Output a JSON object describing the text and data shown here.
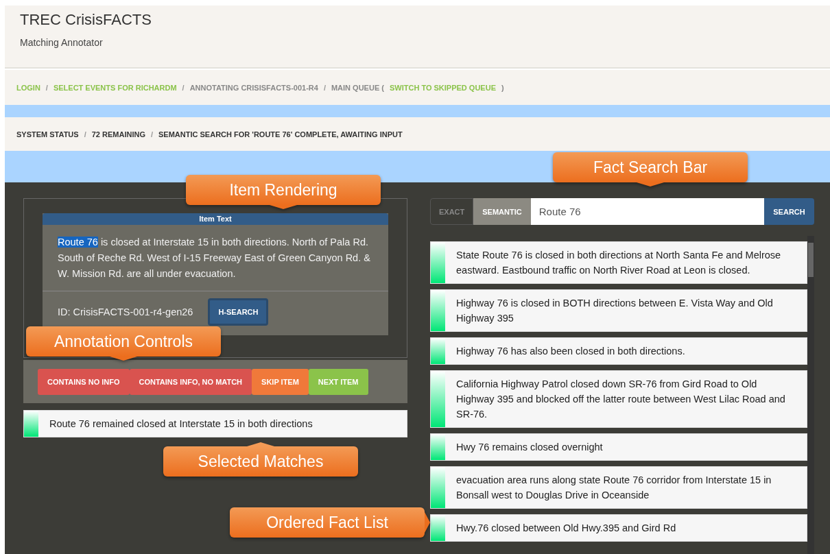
{
  "header": {
    "title": "TREC CrisisFACTS",
    "subtitle": "Matching Annotator"
  },
  "breadcrumb": [
    {
      "label": "LOGIN",
      "kind": "link"
    },
    {
      "label": "SELECT EVENTS FOR RICHARDM",
      "kind": "link"
    },
    {
      "label": "ANNOTATING CRISISFACTS-001-R4",
      "kind": "text"
    },
    {
      "label": "MAIN QUEUE (",
      "kind": "text",
      "link": "SWITCH TO SKIPPED QUEUE",
      "after": ")"
    }
  ],
  "status": [
    "SYSTEM STATUS",
    "72 REMAINING",
    "SEMANTIC SEARCH FOR 'ROUTE 76' COMPLETE, AWAITING INPUT"
  ],
  "item": {
    "header": "Item Text",
    "highlight": "Route 76",
    "text": " is closed at Interstate 15 in both directions. North of Pala Rd. South of Reche Rd. West of I-15 Freeway East of Green Canyon Rd. & W. Mission Rd. are all under evacuation.",
    "id": "ID: CrisisFACTS-001-r4-gen26",
    "button": "H-SEARCH"
  },
  "controls": [
    {
      "label": "CONTAINS NO INFO",
      "kind": "danger"
    },
    {
      "label": "CONTAINS INFO, NO MATCH",
      "kind": "danger"
    },
    {
      "label": "SKIP ITEM",
      "kind": "warning"
    },
    {
      "label": "NEXT ITEM",
      "kind": "success"
    }
  ],
  "selected_matches": [
    "Route 76 remained closed at Interstate 15 in both directions"
  ],
  "search": {
    "modes": [
      {
        "label": "EXACT",
        "selected": false
      },
      {
        "label": "SEMANTIC",
        "selected": true
      }
    ],
    "value": "Route 76",
    "button": "SEARCH"
  },
  "facts": [
    "State Route 76 is closed in both directions at North Santa Fe and Melrose eastward. Eastbound traffic on North River Road at Leon is closed.",
    "Highway 76 is closed in BOTH directions between E. Vista Way and Old Highway 395",
    "Highway 76 has also been closed in both directions.",
    "California Highway Patrol closed down SR-76 from Gird Road to Old Highway 395 and blocked off the latter route between West Lilac Road and SR-76.",
    "Hwy 76 remains closed overnight",
    "evacuation area runs along state Route 76 corridor from Interstate 15 in Bonsall west to Douglas Drive in Oceanside",
    "Hwy.76 closed between Old Hwy.395 and Gird Rd"
  ],
  "callouts": [
    "Fact Search Bar",
    "Item Rendering",
    "Annotation Controls",
    "Selected Matches",
    "Ordered Fact List"
  ],
  "separator": "/"
}
